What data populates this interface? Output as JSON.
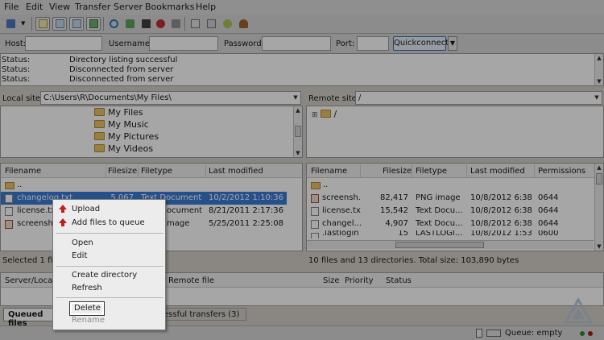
{
  "menu": [
    "File",
    "Edit",
    "View",
    "Transfer",
    "Server",
    "Bookmarks",
    "Help"
  ],
  "toolbar": {
    "icons": [
      "site-manager-icon",
      "dropdown-icon",
      "message-log-icon",
      "local-tree-icon",
      "remote-tree-icon",
      "transfer-queue-icon",
      "refresh-icon",
      "process-queue-icon",
      "cancel-icon",
      "disconnect-icon",
      "reconnect-icon",
      "filter-icon",
      "compare-icon",
      "sync-browse-icon",
      "search-icon"
    ]
  },
  "quickconnect": {
    "host_label": "Host:",
    "username_label": "Username:",
    "password_label": "Password:",
    "port_label": "Port:",
    "button_label": "Quickconnect"
  },
  "log": [
    {
      "k": "Status:",
      "v": "Directory listing successful"
    },
    {
      "k": "Status:",
      "v": "Disconnected from server"
    },
    {
      "k": "Status:",
      "v": "Disconnected from server"
    }
  ],
  "local": {
    "site_label": "Local site:",
    "site_path": "C:\\Users\\R\\Documents\\My Files\\",
    "tree": [
      "My Files",
      "My Music",
      "My Pictures",
      "My Videos"
    ],
    "columns": [
      "Filename",
      "Filesize",
      "Filetype",
      "Last modified"
    ],
    "parent": "..",
    "files": [
      {
        "name": "changelog.txt",
        "size": "5,067",
        "type": "Text Document",
        "modified": "10/2/2012 1:10:36 ..."
      },
      {
        "name": "license.txt",
        "size": "",
        "type": "ocument",
        "modified": "8/21/2011 2:17:36 ..."
      },
      {
        "name": "screenshot",
        "size": "",
        "type": "mage",
        "modified": "5/25/2011 2:25:08 ..."
      }
    ],
    "status": "Selected 1 file."
  },
  "remote": {
    "site_label": "Remote site:",
    "site_path": "/",
    "tree_root": "/",
    "columns": [
      "Filename",
      "Filesize",
      "Filetype",
      "Last modified",
      "Permissions"
    ],
    "parent": "..",
    "files": [
      {
        "name": "screensh...",
        "size": "82,417",
        "type": "PNG image",
        "modified": "10/8/2012 6:38:...",
        "perm": "0644"
      },
      {
        "name": "license.txt",
        "size": "15,542",
        "type": "Text Docu...",
        "modified": "10/8/2012 6:38:...",
        "perm": "0644"
      },
      {
        "name": "changel...",
        "size": "4,907",
        "type": "Text Docu...",
        "modified": "10/8/2012 6:38:...",
        "perm": "0644"
      },
      {
        "name": ".lastlogin",
        "size": "15",
        "type": "LASTLOGI...",
        "modified": "10/8/2012 1:53:...",
        "perm": "0600"
      }
    ],
    "status": "10 files and 13 directories. Total size: 103,890 bytes"
  },
  "queue": {
    "columns": [
      "Server/Local f",
      "Remote file",
      "Size",
      "Priority",
      "Status"
    ],
    "tabs": [
      "Queued files",
      "essful transfers (3)"
    ],
    "status": "Queue: empty"
  },
  "context_menu": {
    "items": [
      "Upload",
      "Add files to queue",
      "Open",
      "Edit",
      "Create directory",
      "Refresh",
      "Delete",
      "Rename"
    ]
  }
}
